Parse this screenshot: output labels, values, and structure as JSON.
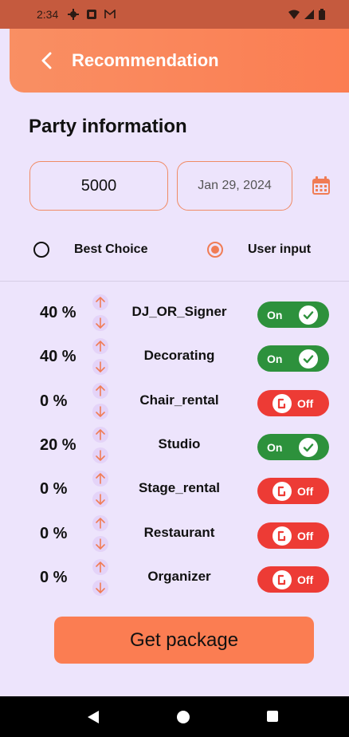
{
  "status_bar": {
    "time": "2:34",
    "left_icons": [
      "settings-icon",
      "notification-icon",
      "gmail-icon"
    ],
    "right_icons": [
      "wifi-icon",
      "signal-icon",
      "battery-icon"
    ]
  },
  "app_bar": {
    "title": "Recommendation",
    "back_icon": "chevron-left-icon"
  },
  "section": {
    "title": "Party information"
  },
  "inputs": {
    "budget": "5000",
    "date": "Jan 29, 2024"
  },
  "radio": {
    "best_choice": {
      "label": "Best Choice",
      "selected": false
    },
    "user_input": {
      "label": "User input",
      "selected": true
    }
  },
  "services": [
    {
      "percent": "40 %",
      "name": "DJ_OR_Signer",
      "state": "On"
    },
    {
      "percent": "40 %",
      "name": "Decorating",
      "state": "On"
    },
    {
      "percent": "0 %",
      "name": "Chair_rental",
      "state": "Off"
    },
    {
      "percent": "20 %",
      "name": "Studio",
      "state": "On"
    },
    {
      "percent": "0 %",
      "name": "Stage_rental",
      "state": "Off"
    },
    {
      "percent": "0 %",
      "name": "Restaurant",
      "state": "Off"
    },
    {
      "percent": "0 %",
      "name": "Organizer",
      "state": "Off"
    }
  ],
  "actions": {
    "get_package": "Get package"
  },
  "colors": {
    "accent": "#fb7d52",
    "background": "#ede4fc",
    "toggle_on": "#2d913c",
    "toggle_off": "#ed3b35"
  }
}
